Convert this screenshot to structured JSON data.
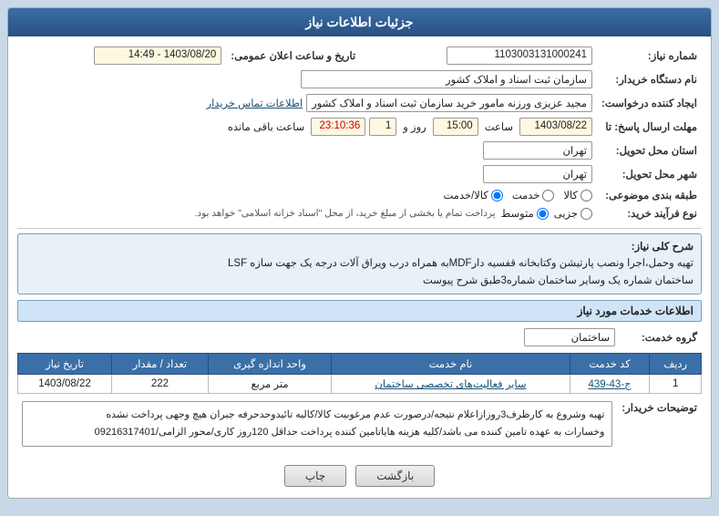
{
  "header": {
    "title": "جزئیات اطلاعات نیاز"
  },
  "fields": {
    "need_number_label": "شماره نیاز:",
    "need_number_value": "1103003131000241",
    "buyer_org_label": "نام دستگاه خریدار:",
    "buyer_org_value": "سازمان ثبت اسناد و املاک کشور",
    "requester_label": "ایجاد کننده درخواست:",
    "requester_value": "مجید عزیزی ورزنه مامور خرید سازمان ثبت اسناد و املاک کشور",
    "requester_link": "اطلاعات تماس خریدار",
    "response_deadline_label": "مهلت ارسال پاسخ: تا",
    "date_label": "تاریخ و ساعت اعلان عمومی:",
    "date_value": "1403/08/20 - 14:49",
    "response_date": "1403/08/22",
    "response_time": "15:00",
    "response_days": "1",
    "response_remaining": "23:10:36",
    "response_days_label": "روز و",
    "response_time_label": "ساعت",
    "response_remaining_label": "ساعت باقی مانده",
    "province_label": "استان محل تحویل:",
    "province_value": "تهران",
    "city_label": "شهر محل تحویل:",
    "city_value": "تهران",
    "category_label": "طبقه بندی موضوعی:",
    "category_goods": "کالا",
    "category_service": "خدمت",
    "category_goods_service": "کالا/خدمت",
    "process_label": "نوع فرآیند خرید:",
    "process_partial": "جزیی",
    "process_medium": "متوسط",
    "process_note": "پرداخت تمام یا بخشی از مبلغ خرید، از محل \"اسناد خزانه اسلامی\" خواهد بود."
  },
  "summary": {
    "label": "شرح کلی نیاز:",
    "content_line1": "تهیه وحمل،اجرا ونصب پارتیشن وکتابخانه قفسیه دارMDFبه همراه درب ویراق آلات درجه یک جهت سازه LSF",
    "content_line2": "ساختمان شماره یک وسایر ساختمان شماره3طبق شرح پیوست"
  },
  "service_info": {
    "label": "اطلاعات خدمات مورد نیاز",
    "group_label": "گروه خدمت:",
    "group_value": "ساختمان",
    "table_headers": [
      "ردیف",
      "کد خدمت",
      "نام خدمت",
      "واحد اندازه گیری",
      "تعداد / مقدار",
      "تاریخ نیاز"
    ],
    "table_rows": [
      {
        "row": "1",
        "code": "ج-43-439",
        "name": "سایر فعالیت‌های تخصصی ساختمان",
        "unit": "متر مربع",
        "quantity": "222",
        "date": "1403/08/22"
      }
    ]
  },
  "buyer_notes": {
    "label": "توضیحات خریدار:",
    "content_line1": "تهیه وشروع به کارظرف3روزازاعلام نتیجه/درصورت عدم مرغوبیت کالا/کالیه تائیدوحدحرفه جبران هیچ وجهی پرداخت نشده",
    "content_line2": "وخسارات به عهده تامین کننده می باشد/کلیه هزینه هایاتامین کننده پرداخت حداقل 120روز کاری/محور الزامی/09216317401"
  },
  "buttons": {
    "back": "بازگشت",
    "print": "چاپ"
  },
  "icons": {
    "radio_selected": "●",
    "radio_unselected": "○"
  }
}
